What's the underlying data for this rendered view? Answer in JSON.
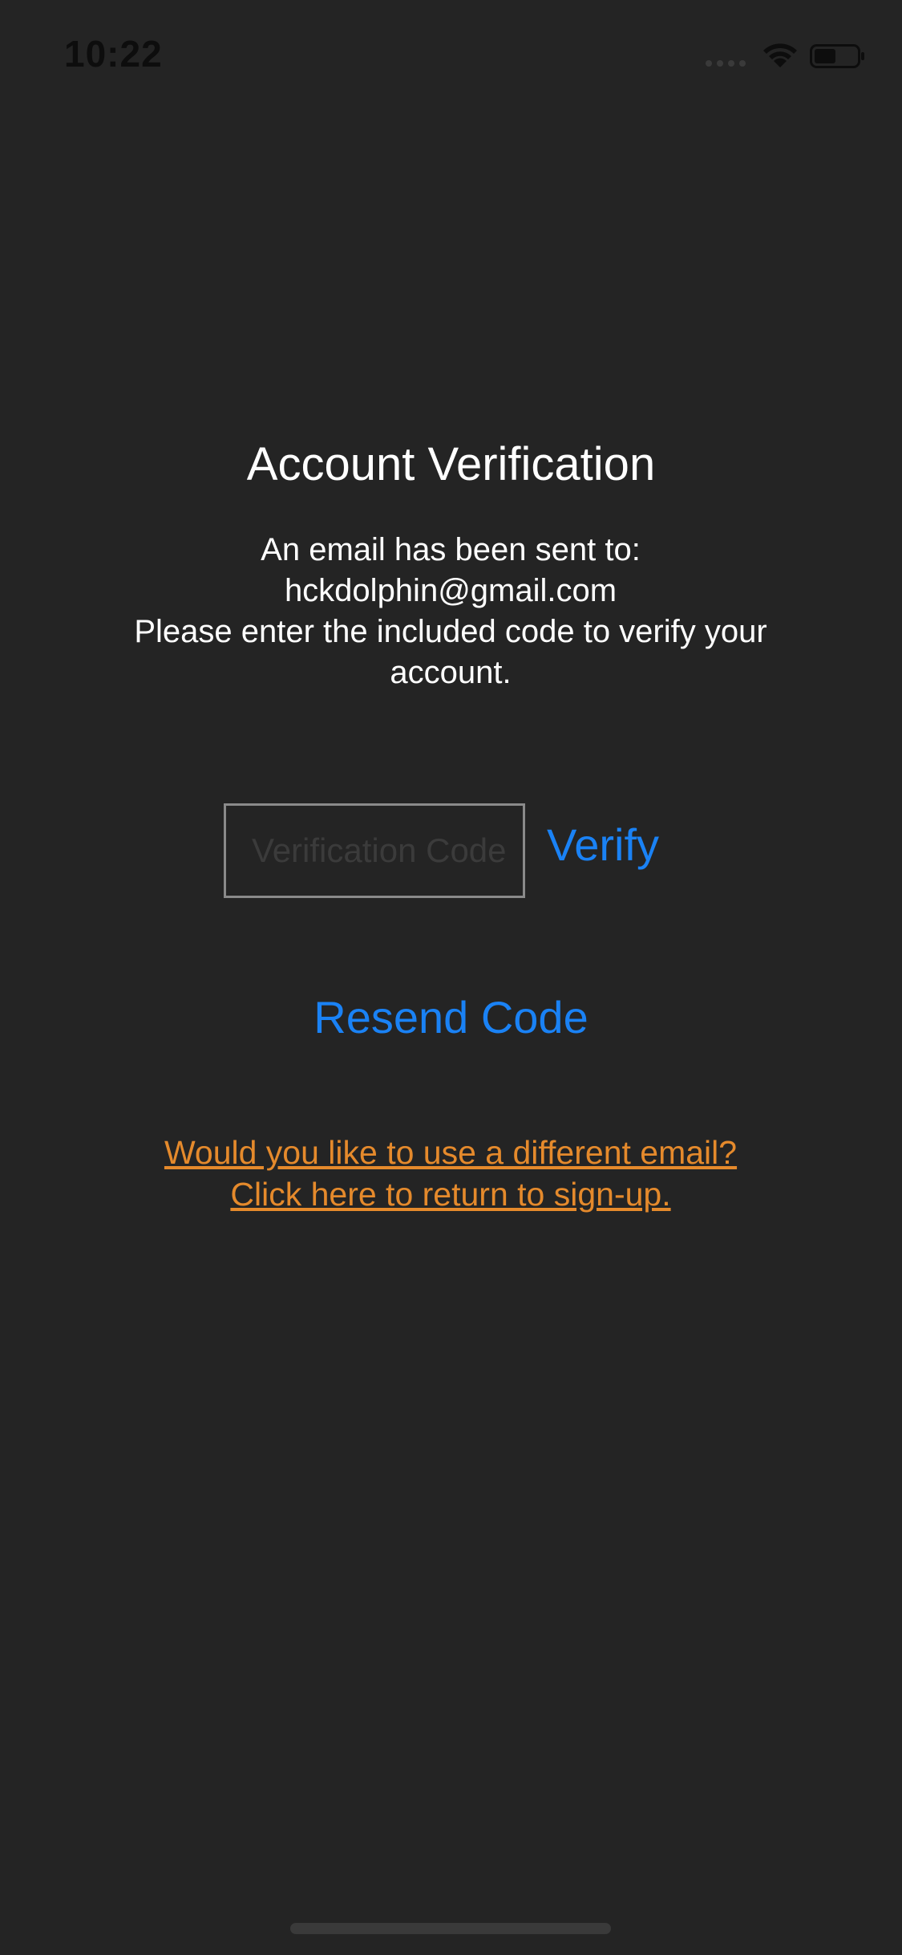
{
  "status_bar": {
    "time": "10:22"
  },
  "verification": {
    "title": "Account Verification",
    "message_line1": "An email has been sent to:",
    "email": "hckdolphin@gmail.com",
    "message_line3": "Please enter the included code to verify your",
    "message_line4": "account.",
    "code_placeholder": "Verification Code",
    "code_value": "",
    "verify_label": "Verify",
    "resend_label": "Resend Code",
    "signup_link_line1": "Would you like to use a different email?",
    "signup_link_line2": "Click here to return to sign-up."
  },
  "colors": {
    "background": "#242424",
    "accent_blue": "#1a82f5",
    "link_orange": "#e58a2c",
    "input_border": "#8a8a8a"
  },
  "icons": {
    "status": [
      "cellular-signal-icon",
      "wifi-icon",
      "battery-icon"
    ]
  }
}
